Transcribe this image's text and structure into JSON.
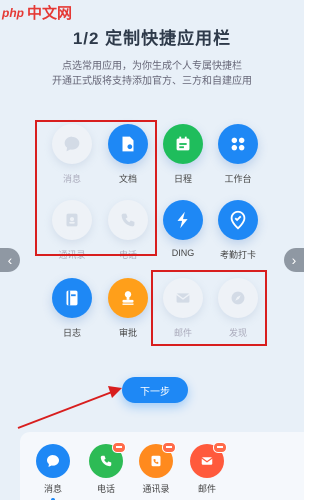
{
  "watermark": {
    "prefix": "php",
    "name": "中文网"
  },
  "header": {
    "title": "1/2 定制快捷应用栏",
    "subtitle_line1": "点选常用应用，为你生成个人专属快捷栏",
    "subtitle_line2": "开通正式版将支持添加官方、三方和自建应用"
  },
  "apps": [
    {
      "label": "消息",
      "icon": "message-icon",
      "state": "selected"
    },
    {
      "label": "文档",
      "icon": "document-icon",
      "state": "available"
    },
    {
      "label": "日程",
      "icon": "calendar-icon",
      "state": "available"
    },
    {
      "label": "工作台",
      "icon": "workbench-icon",
      "state": "available"
    },
    {
      "label": "通讯录",
      "icon": "contacts-icon",
      "state": "selected"
    },
    {
      "label": "电话",
      "icon": "phone-icon",
      "state": "selected"
    },
    {
      "label": "DING",
      "icon": "ding-icon",
      "state": "available"
    },
    {
      "label": "考勤打卡",
      "icon": "attendance-icon",
      "state": "available"
    },
    {
      "label": "日志",
      "icon": "log-icon",
      "state": "available"
    },
    {
      "label": "审批",
      "icon": "approval-icon",
      "state": "available"
    },
    {
      "label": "邮件",
      "icon": "mail-icon",
      "state": "selected"
    },
    {
      "label": "发现",
      "icon": "discover-icon",
      "state": "selected"
    }
  ],
  "next_button": {
    "label": "下一步"
  },
  "dock": [
    {
      "label": "消息",
      "icon": "message-icon",
      "color": "#1e88f5",
      "active": true
    },
    {
      "label": "电话",
      "icon": "phone-icon",
      "color": "#2dbb55",
      "active": false
    },
    {
      "label": "通讯录",
      "icon": "contacts-icon",
      "color": "#ff8a1e",
      "active": false
    },
    {
      "label": "邮件",
      "icon": "mail-icon",
      "color": "#ff5a3c",
      "active": false
    }
  ],
  "colors": {
    "accent": "#1e88f5",
    "green": "#1fbd5c",
    "orange": "#ff9f1a",
    "highlight": "#d81e1e"
  }
}
